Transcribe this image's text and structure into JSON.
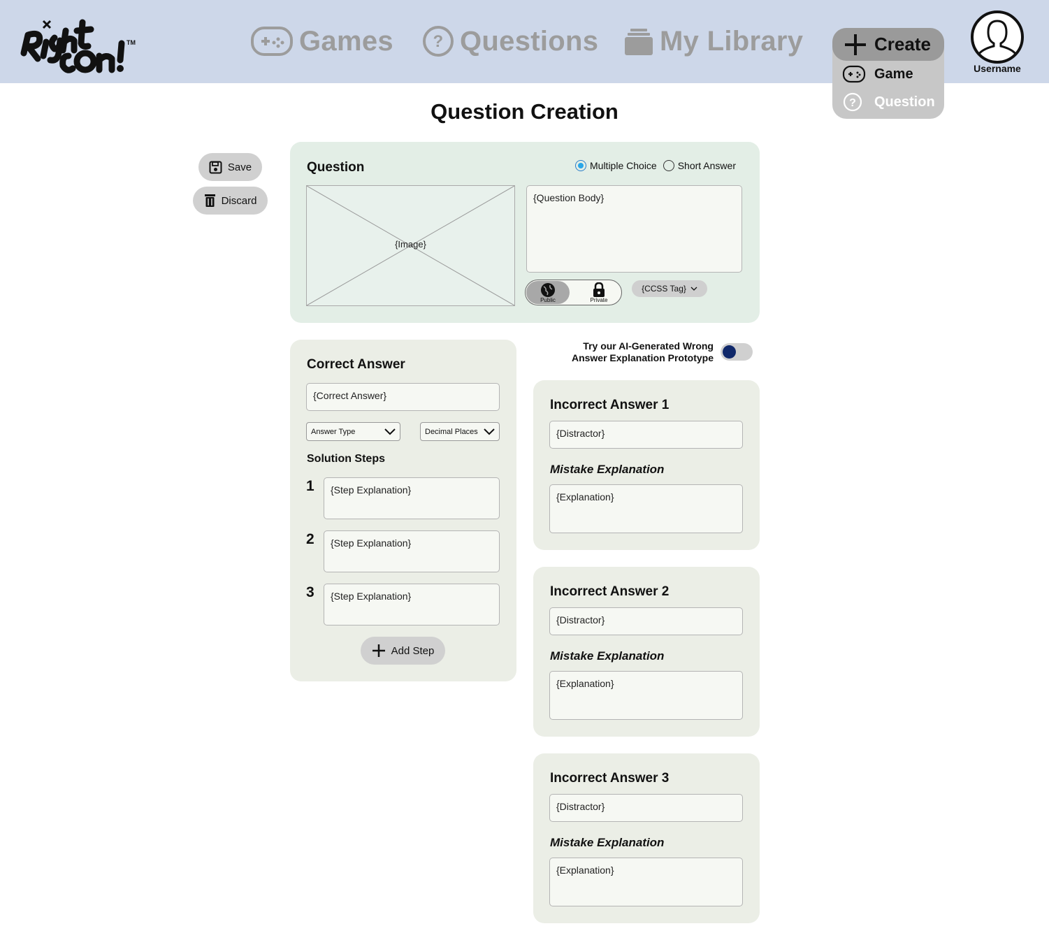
{
  "header": {
    "nav": [
      {
        "label": "Games",
        "icon": "gamepad-icon"
      },
      {
        "label": "Questions",
        "icon": "question-circle-icon"
      },
      {
        "label": "My Library",
        "icon": "library-icon"
      }
    ],
    "create": {
      "label": "Create",
      "items": [
        {
          "label": "Game",
          "icon": "gamepad-icon"
        },
        {
          "label": "Question",
          "icon": "question-circle-icon"
        }
      ]
    },
    "username": "Username"
  },
  "page": {
    "title": "Question Creation"
  },
  "actions": {
    "save": "Save",
    "discard": "Discard"
  },
  "question": {
    "heading": "Question",
    "types": [
      {
        "label": "Multiple Choice",
        "selected": true
      },
      {
        "label": "Short Answer",
        "selected": false
      }
    ],
    "image_placeholder": "{Image}",
    "body_placeholder": "{Question Body}",
    "visibility": {
      "public": "Public",
      "private": "Private",
      "selected": "Public"
    },
    "ccss_tag": "{CCSS Tag}"
  },
  "ai_toggle": {
    "line1": "Try our AI-Generated Wrong",
    "line2": "Answer Explanation Prototype",
    "on": true
  },
  "correct": {
    "heading": "Correct Answer",
    "value": "{Correct Answer}",
    "answer_type": "Answer Type",
    "decimal_places": "Decimal Places",
    "steps_heading": "Solution Steps",
    "steps": [
      {
        "num": "1",
        "text": "{Step Explanation}"
      },
      {
        "num": "2",
        "text": "{Step Explanation}"
      },
      {
        "num": "3",
        "text": "{Step Explanation}"
      }
    ],
    "add_step": "Add Step"
  },
  "incorrect": [
    {
      "heading": "Incorrect Answer 1",
      "distractor": "{Distractor}",
      "mistake_heading": "Mistake Explanation",
      "explanation": "{Explanation}"
    },
    {
      "heading": "Incorrect Answer 2",
      "distractor": "{Distractor}",
      "mistake_heading": "Mistake Explanation",
      "explanation": "{Explanation}"
    },
    {
      "heading": "Incorrect Answer 3",
      "distractor": "{Distractor}",
      "mistake_heading": "Mistake Explanation",
      "explanation": "{Explanation}"
    }
  ],
  "colors": {
    "header_bg": "#cdd7e9",
    "question_card": "#e3eee6",
    "answer_card": "#ebeee6",
    "toggle_knob": "#10286a",
    "radio_selected": "#2aa6e8"
  }
}
